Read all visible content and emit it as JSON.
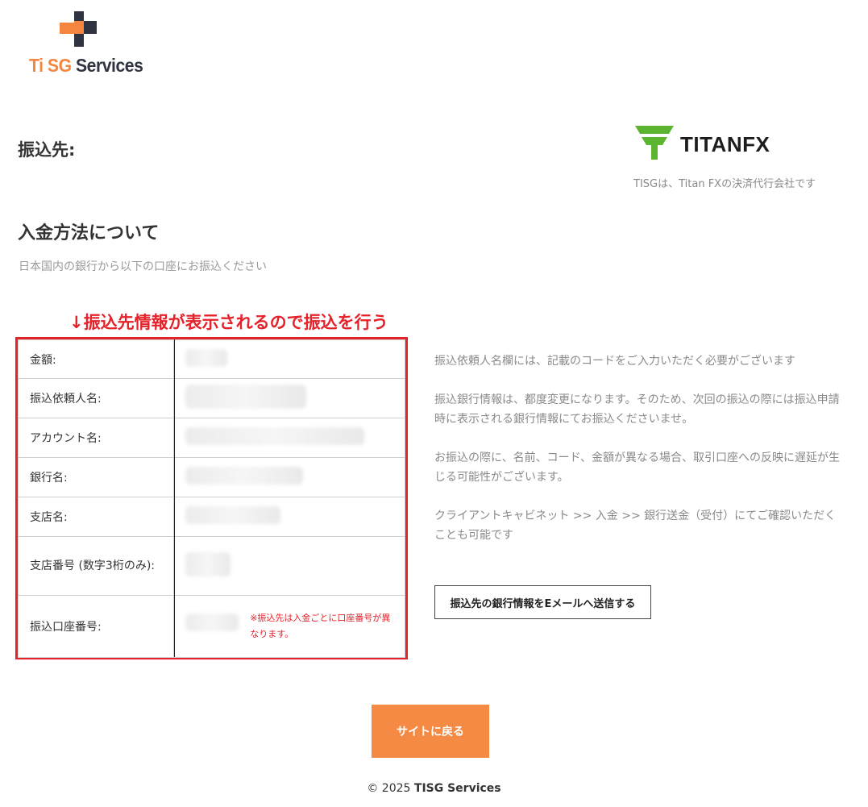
{
  "logo": {
    "ti": "Ti SG",
    "services": "Services"
  },
  "recipient_heading": "振込先:",
  "titan": {
    "word_a": "TITAN",
    "word_b": "FX",
    "caption": "TISGは、Titan FXの決済代行会社です"
  },
  "method": {
    "heading": "入金方法について",
    "subtitle": "日本国内の銀行から以下の口座にお振込ください"
  },
  "annotation": "↓振込先情報が表示されるので振込を行う",
  "table": {
    "rows": [
      {
        "label": "金額:"
      },
      {
        "label": "振込依頼人名:"
      },
      {
        "label": "アカウント名:"
      },
      {
        "label": "銀行名:"
      },
      {
        "label": "支店名:"
      },
      {
        "label": "支店番号 (数字3桁のみ):"
      },
      {
        "label": "振込口座番号:"
      }
    ],
    "account_note": "※振込先は入金ごとに口座番号が異なります。"
  },
  "notes": [
    "振込依頼人名欄には、記載のコードをご入力いただく必要がございます",
    "振込銀行情報は、都度変更になります。そのため、次回の振込の際には振込申請時に表示される銀行情報にてお振込くださいませ。",
    "お振込の際に、名前、コード、金額が異なる場合、取引口座への反映に遅延が生じる可能性がございます。",
    "クライアントキャビネット >> 入金 >> 銀行送金（受付）にてご確認いただくことも可能です"
  ],
  "email_button": "振込先の銀行情報をEメールへ送信する",
  "back_button": "サイトに戻る",
  "footer": {
    "copyright": "© 2025",
    "company": "TISG Services"
  },
  "colors": {
    "accent_orange": "#f58a45",
    "annotation_red": "#e5212a",
    "titan_green": "#5cb531"
  }
}
